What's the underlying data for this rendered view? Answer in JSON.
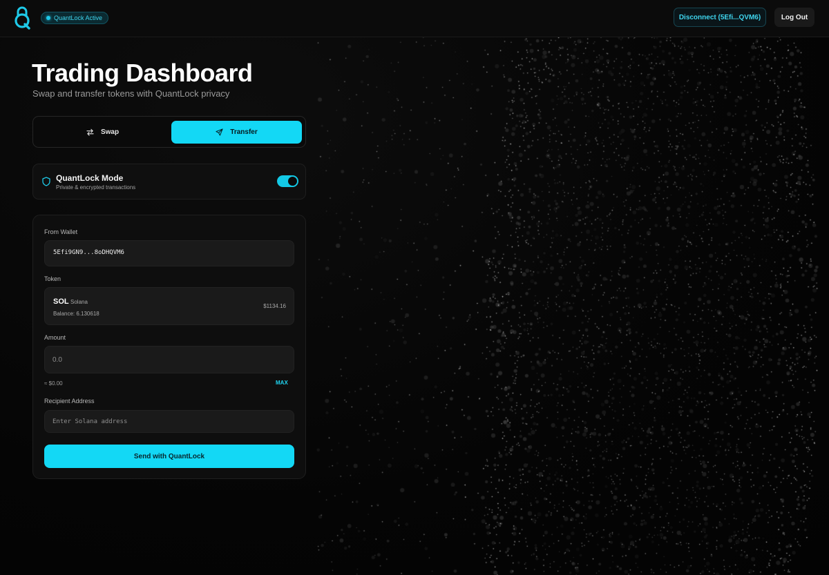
{
  "header": {
    "status_badge": "QuantLock Active",
    "disconnect_label": "Disconnect (5Efi...QVM6)",
    "logout_label": "Log Out"
  },
  "page": {
    "title": "Trading Dashboard",
    "subtitle": "Swap and transfer tokens with QuantLock privacy"
  },
  "tabs": [
    {
      "label": "Swap",
      "icon": "swap-arrows-icon",
      "active": false
    },
    {
      "label": "Transfer",
      "icon": "send-icon",
      "active": true
    }
  ],
  "mode": {
    "title": "QuantLock Mode",
    "description": "Private & encrypted transactions",
    "icon": "shield-icon",
    "enabled": true
  },
  "form": {
    "from_wallet_label": "From Wallet",
    "from_wallet_value": "5Efi9GN9...8oDHQVM6",
    "token_label": "Token",
    "token": {
      "symbol": "SOL",
      "name": "Solana",
      "balance": "Balance: 6.130618",
      "price": "$1134.16"
    },
    "amount_label": "Amount",
    "amount_placeholder": "0.0",
    "usd_value": "≈ $0.00",
    "max_label": "MAX",
    "recipient_label": "Recipient Address",
    "recipient_placeholder": "Enter Solana address",
    "submit_label": "Send with QuantLock"
  },
  "colors": {
    "accent": "#13d8f5",
    "background": "#050505",
    "card": "#0e0e0e"
  }
}
